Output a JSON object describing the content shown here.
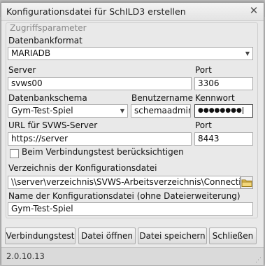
{
  "window": {
    "title": "Konfigurationsdatei für SchILD3 erstellen"
  },
  "group": {
    "legend": "Zugriffsparameter"
  },
  "db_format": {
    "label": "Datenbankformat",
    "value": "MARIADB"
  },
  "server": {
    "label": "Server",
    "value": "svws00"
  },
  "port1": {
    "label": "Port",
    "value": "3306"
  },
  "schema": {
    "label": "Datenbankschema",
    "value": "Gym-Test-Spiel"
  },
  "user": {
    "label": "Benutzername",
    "value": "schemaadmin"
  },
  "password": {
    "label": "Kennwort",
    "value": "●●●●●●●●"
  },
  "url": {
    "label": "URL für SVWS-Server",
    "value": "https://server"
  },
  "port2": {
    "label": "Port",
    "value": "8443"
  },
  "connect_test": {
    "label": "Beim Verbindungstest berücksichtigen",
    "checked": false
  },
  "config_dir": {
    "label": "Verzeichnis der Konfigurationsdatei",
    "value": "\\\\server\\verzeichnis\\SVWS-Arbeitsverzeichnis\\Connection-F"
  },
  "config_name": {
    "label": "Name der Konfigurationsdatei (ohne Dateierweiterung)",
    "value": "Gym-Test-Spiel"
  },
  "buttons": {
    "test": "Verbindungstest",
    "open": "Datei öffnen",
    "save": "Datei speichern",
    "close": "Schließen"
  },
  "status": {
    "version": "2.0.10.13"
  },
  "icons": {
    "close": "close-icon",
    "folder": "folder-icon",
    "dropdown": "chevron-down-icon"
  }
}
